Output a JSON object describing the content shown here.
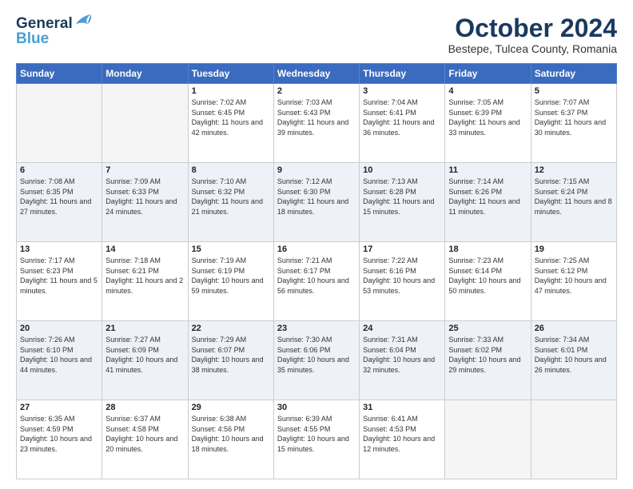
{
  "logo": {
    "line1": "General",
    "line2": "Blue"
  },
  "header": {
    "month": "October 2024",
    "location": "Bestepe, Tulcea County, Romania"
  },
  "weekdays": [
    "Sunday",
    "Monday",
    "Tuesday",
    "Wednesday",
    "Thursday",
    "Friday",
    "Saturday"
  ],
  "weeks": [
    [
      {
        "day": "",
        "info": ""
      },
      {
        "day": "",
        "info": ""
      },
      {
        "day": "1",
        "info": "Sunrise: 7:02 AM\nSunset: 6:45 PM\nDaylight: 11 hours and 42 minutes."
      },
      {
        "day": "2",
        "info": "Sunrise: 7:03 AM\nSunset: 6:43 PM\nDaylight: 11 hours and 39 minutes."
      },
      {
        "day": "3",
        "info": "Sunrise: 7:04 AM\nSunset: 6:41 PM\nDaylight: 11 hours and 36 minutes."
      },
      {
        "day": "4",
        "info": "Sunrise: 7:05 AM\nSunset: 6:39 PM\nDaylight: 11 hours and 33 minutes."
      },
      {
        "day": "5",
        "info": "Sunrise: 7:07 AM\nSunset: 6:37 PM\nDaylight: 11 hours and 30 minutes."
      }
    ],
    [
      {
        "day": "6",
        "info": "Sunrise: 7:08 AM\nSunset: 6:35 PM\nDaylight: 11 hours and 27 minutes."
      },
      {
        "day": "7",
        "info": "Sunrise: 7:09 AM\nSunset: 6:33 PM\nDaylight: 11 hours and 24 minutes."
      },
      {
        "day": "8",
        "info": "Sunrise: 7:10 AM\nSunset: 6:32 PM\nDaylight: 11 hours and 21 minutes."
      },
      {
        "day": "9",
        "info": "Sunrise: 7:12 AM\nSunset: 6:30 PM\nDaylight: 11 hours and 18 minutes."
      },
      {
        "day": "10",
        "info": "Sunrise: 7:13 AM\nSunset: 6:28 PM\nDaylight: 11 hours and 15 minutes."
      },
      {
        "day": "11",
        "info": "Sunrise: 7:14 AM\nSunset: 6:26 PM\nDaylight: 11 hours and 11 minutes."
      },
      {
        "day": "12",
        "info": "Sunrise: 7:15 AM\nSunset: 6:24 PM\nDaylight: 11 hours and 8 minutes."
      }
    ],
    [
      {
        "day": "13",
        "info": "Sunrise: 7:17 AM\nSunset: 6:23 PM\nDaylight: 11 hours and 5 minutes."
      },
      {
        "day": "14",
        "info": "Sunrise: 7:18 AM\nSunset: 6:21 PM\nDaylight: 11 hours and 2 minutes."
      },
      {
        "day": "15",
        "info": "Sunrise: 7:19 AM\nSunset: 6:19 PM\nDaylight: 10 hours and 59 minutes."
      },
      {
        "day": "16",
        "info": "Sunrise: 7:21 AM\nSunset: 6:17 PM\nDaylight: 10 hours and 56 minutes."
      },
      {
        "day": "17",
        "info": "Sunrise: 7:22 AM\nSunset: 6:16 PM\nDaylight: 10 hours and 53 minutes."
      },
      {
        "day": "18",
        "info": "Sunrise: 7:23 AM\nSunset: 6:14 PM\nDaylight: 10 hours and 50 minutes."
      },
      {
        "day": "19",
        "info": "Sunrise: 7:25 AM\nSunset: 6:12 PM\nDaylight: 10 hours and 47 minutes."
      }
    ],
    [
      {
        "day": "20",
        "info": "Sunrise: 7:26 AM\nSunset: 6:10 PM\nDaylight: 10 hours and 44 minutes."
      },
      {
        "day": "21",
        "info": "Sunrise: 7:27 AM\nSunset: 6:09 PM\nDaylight: 10 hours and 41 minutes."
      },
      {
        "day": "22",
        "info": "Sunrise: 7:29 AM\nSunset: 6:07 PM\nDaylight: 10 hours and 38 minutes."
      },
      {
        "day": "23",
        "info": "Sunrise: 7:30 AM\nSunset: 6:06 PM\nDaylight: 10 hours and 35 minutes."
      },
      {
        "day": "24",
        "info": "Sunrise: 7:31 AM\nSunset: 6:04 PM\nDaylight: 10 hours and 32 minutes."
      },
      {
        "day": "25",
        "info": "Sunrise: 7:33 AM\nSunset: 6:02 PM\nDaylight: 10 hours and 29 minutes."
      },
      {
        "day": "26",
        "info": "Sunrise: 7:34 AM\nSunset: 6:01 PM\nDaylight: 10 hours and 26 minutes."
      }
    ],
    [
      {
        "day": "27",
        "info": "Sunrise: 6:35 AM\nSunset: 4:59 PM\nDaylight: 10 hours and 23 minutes."
      },
      {
        "day": "28",
        "info": "Sunrise: 6:37 AM\nSunset: 4:58 PM\nDaylight: 10 hours and 20 minutes."
      },
      {
        "day": "29",
        "info": "Sunrise: 6:38 AM\nSunset: 4:56 PM\nDaylight: 10 hours and 18 minutes."
      },
      {
        "day": "30",
        "info": "Sunrise: 6:39 AM\nSunset: 4:55 PM\nDaylight: 10 hours and 15 minutes."
      },
      {
        "day": "31",
        "info": "Sunrise: 6:41 AM\nSunset: 4:53 PM\nDaylight: 10 hours and 12 minutes."
      },
      {
        "day": "",
        "info": ""
      },
      {
        "day": "",
        "info": ""
      }
    ]
  ]
}
